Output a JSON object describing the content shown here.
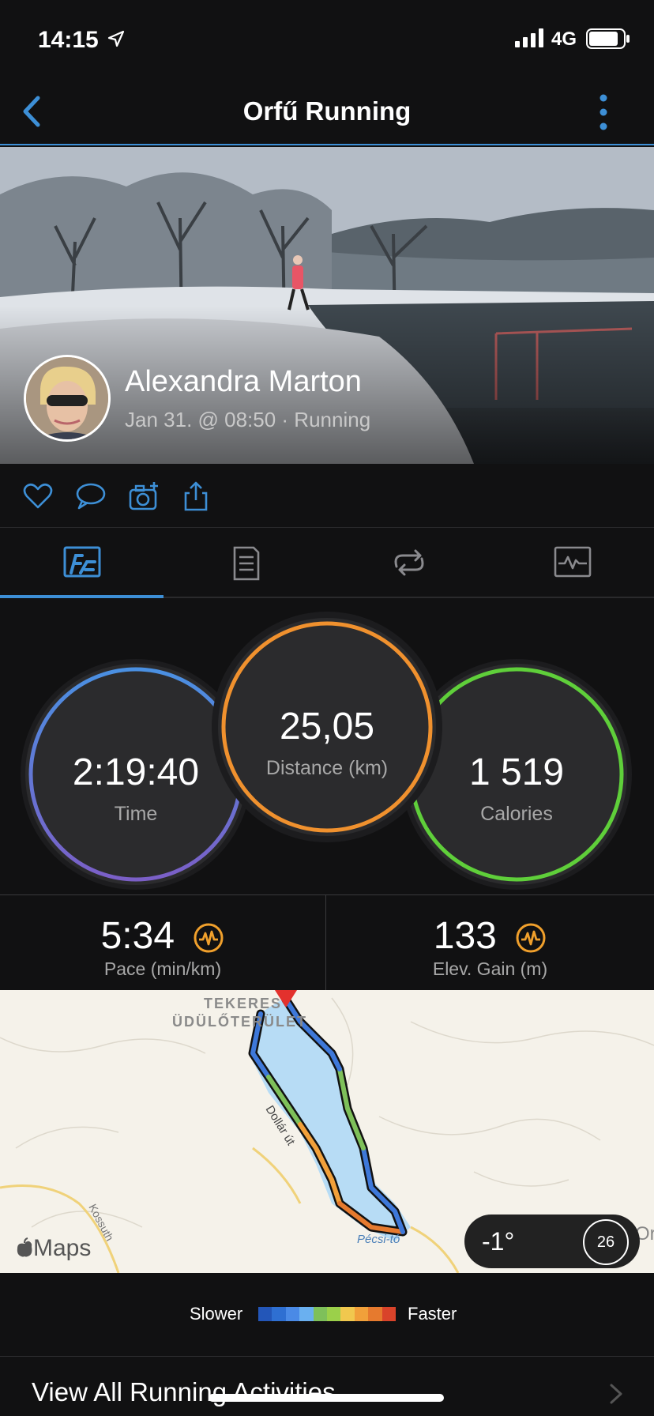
{
  "status_bar": {
    "time": "14:15",
    "network": "4G"
  },
  "nav": {
    "title": "Orfű Running",
    "back_icon": "chevron-left-icon",
    "more_icon": "vertical-ellipsis-icon"
  },
  "activity": {
    "user_name": "Alexandra Marton",
    "meta": "Jan 31. @ 08:50 · Running"
  },
  "actions": [
    "heart-icon",
    "comment-icon",
    "add-photo-icon",
    "share-icon"
  ],
  "tabs": [
    {
      "icon": "stats-icon",
      "active": true
    },
    {
      "icon": "details-icon",
      "active": false
    },
    {
      "icon": "laps-icon",
      "active": false
    },
    {
      "icon": "charts-icon",
      "active": false
    }
  ],
  "stats": {
    "time": {
      "value": "2:19:40",
      "label": "Time"
    },
    "distance": {
      "value": "25,05",
      "label": "Distance (km)"
    },
    "calories": {
      "value": "1 519",
      "label": "Calories"
    }
  },
  "secondary_stats": {
    "pace": {
      "value": "5:34",
      "label": "Pace (min/km)"
    },
    "elevation": {
      "value": "133",
      "label": "Elev. Gain (m)"
    }
  },
  "map": {
    "place_label_1": "TEKERES",
    "place_label_2": "ÜDÜLŐTERÜLET",
    "road_label": "Dollár út",
    "road_label_2": "Kossuth",
    "pond_label": "Pécsi-tó",
    "right_label": "Or",
    "attribution": "Maps",
    "weather_temp": "-1°",
    "wind_speed": "26"
  },
  "legend": {
    "slower": "Slower",
    "faster": "Faster",
    "colors": [
      "#2356b8",
      "#2e6fd2",
      "#4a8ae6",
      "#6ab0f0",
      "#7ec05a",
      "#9bd04a",
      "#f1c84e",
      "#f1a03a",
      "#e67a2e",
      "#d9432a"
    ]
  },
  "footer": {
    "view_all": "View All Running Activities"
  },
  "colors": {
    "accent": "#3d8fd6",
    "time_ring_top": "#4a90e2",
    "time_ring_bottom": "#7b5fc7",
    "distance_ring": "#f0912e",
    "calories_ring": "#5fcf3a",
    "training_effect": "#f0a02c"
  }
}
